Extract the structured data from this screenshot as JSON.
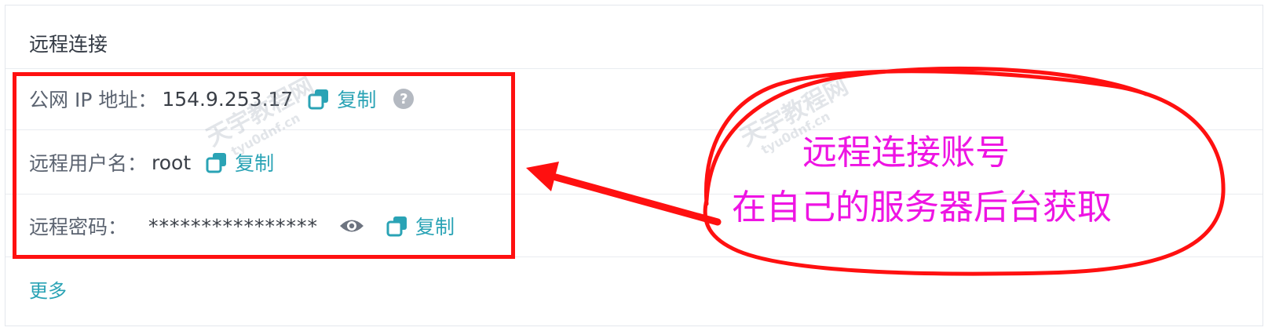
{
  "card": {
    "title": "远程连接",
    "public_ip_label": "公网 IP 地址：",
    "public_ip_value": "154.9.253.17",
    "username_label": "远程用户名：",
    "username_value": "root",
    "password_label": "远程密码：",
    "password_value": "****************",
    "copy_label": "复制",
    "help_glyph": "?",
    "more_label": "更多"
  },
  "annotation": {
    "line1": "远程连接账号",
    "line2": "在自己的服务器后台获取",
    "box_color": "#ff1010",
    "text_color": "#ee14e3",
    "arrow_color": "#ff1010"
  },
  "watermarks": [
    "天宇教程网",
    "tyu0dnf.cn",
    "天宇教程网",
    "tyu0dnf.cn"
  ],
  "icons": {
    "copy": "copy-icon",
    "help": "help-icon",
    "eye": "eye-icon"
  },
  "colors": {
    "accent": "#2aa3b5",
    "text": "#3a3f47",
    "label": "#5b6370",
    "border": "#e4e7ec"
  }
}
